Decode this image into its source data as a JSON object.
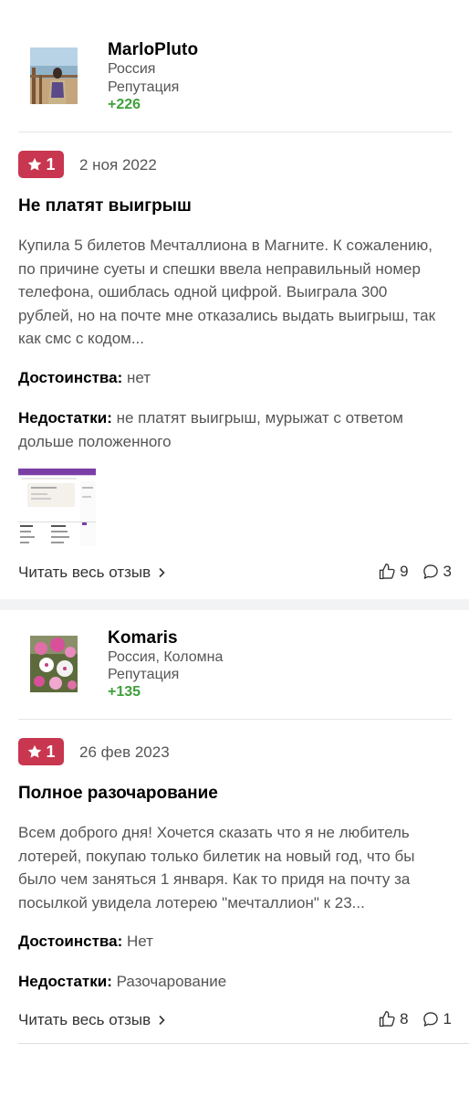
{
  "reviews": [
    {
      "author": {
        "name": "MarloPluto",
        "location": "Россия",
        "reputation_label": "Репутация",
        "reputation_value": "+226"
      },
      "rating": "1",
      "date": "2 ноя 2022",
      "title": "Не платят выигрыш",
      "text": "Купила 5 билетов Мечталлиона в Магните. К сожалению, по причине суеты и спешки ввела неправильный номер телефона, ошиблась одной цифрой. Выиграла 300 рублей, но на почте мне отказались выдать выигрыш, так как смс с кодом...",
      "pros_label": "Достоинства:",
      "pros": "нет",
      "cons_label": "Недостатки:",
      "cons": "не платят выигрыш, мурыжат с ответом дольше положенного",
      "read_more": "Читать весь отзыв",
      "likes": "9",
      "comments": "3"
    },
    {
      "author": {
        "name": "Komaris",
        "location": "Россия, Коломна",
        "reputation_label": "Репутация",
        "reputation_value": "+135"
      },
      "rating": "1",
      "date": "26 фев 2023",
      "title": "Полное разочарование",
      "text": "Всем доброго дня! Хочется сказать что я не любитель лотерей, покупаю только билетик на новый год, что бы было чем заняться 1 января. Как то придя на почту за посылкой увидела лотерею \"мечталлион\" к 23...",
      "pros_label": "Достоинства:",
      "pros": "Нет",
      "cons_label": "Недостатки:",
      "cons": "Разочарование",
      "read_more": "Читать весь отзыв",
      "likes": "8",
      "comments": "1"
    }
  ],
  "colors": {
    "rating_badge": "#c8364f",
    "reputation": "#3fa03a",
    "separator": "#f2f3f5"
  }
}
